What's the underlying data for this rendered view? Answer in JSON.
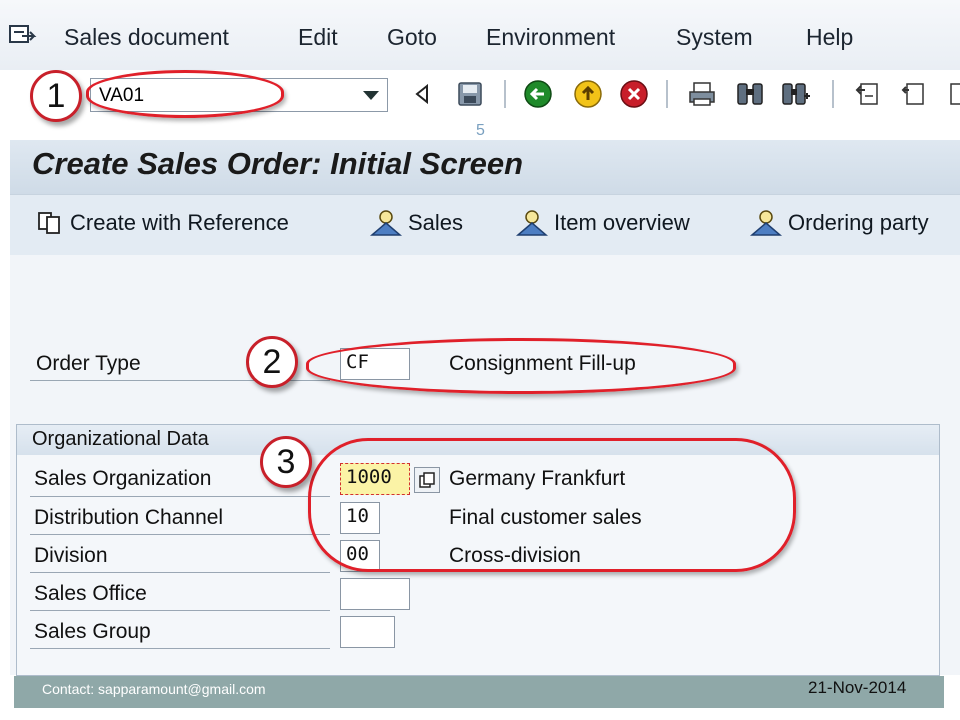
{
  "menu": {
    "items": [
      {
        "label": "Sales document"
      },
      {
        "label": "Edit"
      },
      {
        "label": "Goto"
      },
      {
        "label": "Environment"
      },
      {
        "label": "System"
      },
      {
        "label": "Help"
      }
    ]
  },
  "toolbar": {
    "command_value": "VA01",
    "icons": [
      "back-icon",
      "save-icon",
      "green-back-icon",
      "exit-icon",
      "cancel-icon",
      "print-icon",
      "find-icon",
      "find-next-icon",
      "first-page-icon",
      "previous-page-icon"
    ]
  },
  "slide_number": "5",
  "screen": {
    "title": "Create Sales Order: Initial Screen"
  },
  "app_toolbar": {
    "create_with_reference": "Create with Reference",
    "sales": "Sales",
    "item_overview": "Item overview",
    "ordering_party": "Ordering party"
  },
  "order_type": {
    "label": "Order Type",
    "value": "CF",
    "description": "Consignment Fill-up"
  },
  "org_data": {
    "title": "Organizational Data",
    "sales_org": {
      "label": "Sales Organization",
      "value": "1000",
      "description": "Germany Frankfurt"
    },
    "dist_channel": {
      "label": "Distribution Channel",
      "value": "10",
      "description": "Final customer sales"
    },
    "division": {
      "label": "Division",
      "value": "00",
      "description": "Cross-division"
    },
    "sales_office": {
      "label": "Sales Office",
      "value": ""
    },
    "sales_group": {
      "label": "Sales Group",
      "value": ""
    }
  },
  "annotations": {
    "one": "1",
    "two": "2",
    "three": "3"
  },
  "footer": {
    "contact": "Contact: sapparamount@gmail.com",
    "date": "21-Nov-2014"
  },
  "colors": {
    "annotation_red": "#e0202a",
    "title_bg": "#cfdbe7",
    "footer_bg": "#8fa8a8"
  }
}
